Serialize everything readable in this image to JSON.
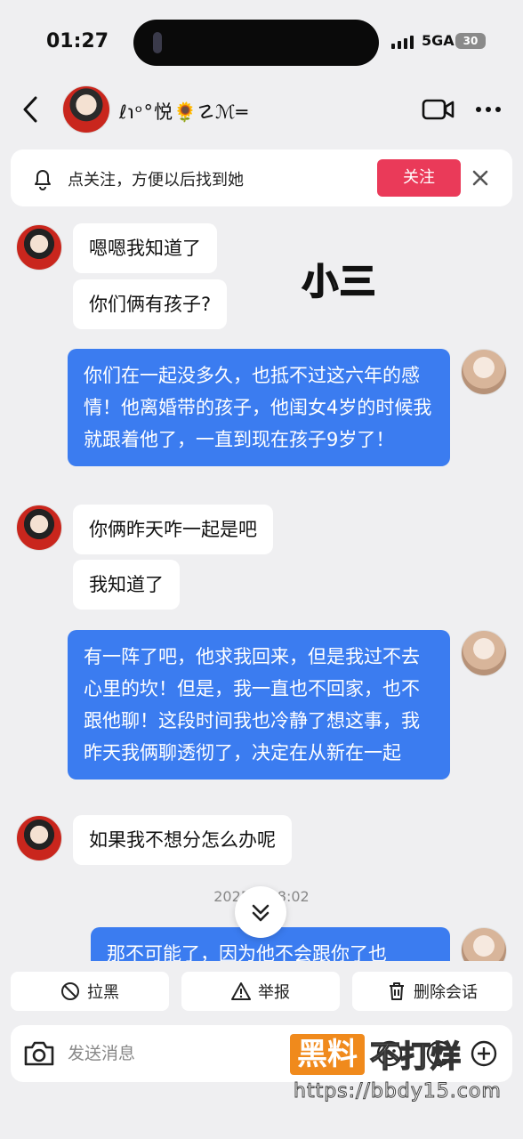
{
  "status_bar": {
    "time": "01:27",
    "network": "5GA",
    "battery": "30"
  },
  "header": {
    "contact_name": "ℓ℩ᵒ°悦🌻☡ℳ═"
  },
  "follow_banner": {
    "text": "点关注，方便以后找到她",
    "button": "关注"
  },
  "overlay_note": "小三",
  "messages": [
    {
      "side": "left",
      "text": "嗯嗯我知道了"
    },
    {
      "side": "left",
      "text": "你们俩有孩子?"
    },
    {
      "side": "right",
      "text": "你们在一起没多久，也抵不过这六年的感情！他离婚带的孩子，他闺女4岁的时候我就跟着他了，一直到现在孩子9岁了！"
    },
    {
      "side": "left",
      "text": "你俩昨天咋一起是吧"
    },
    {
      "side": "left",
      "text": "我知道了"
    },
    {
      "side": "right",
      "text": "有一阵了吧，他求我回来，但是我过不去心里的坎！但是，我一直也不回家，也不跟他聊！这段时间我也冷静了想这事，我昨天我俩聊透彻了，决定在从新在一起"
    },
    {
      "side": "left",
      "text": "如果我不想分怎么办呢"
    },
    {
      "side": "right",
      "text": "那不可能了，因为他不会跟你了也"
    }
  ],
  "timestamp": "2025/1    18:02",
  "actions": {
    "block": "拉黑",
    "report": "举报",
    "delete": "删除会话"
  },
  "input": {
    "placeholder": "发送消息"
  },
  "watermark": {
    "box": "黑料",
    "text": "不打烊",
    "url": "https://bbdy15.com"
  },
  "colors": {
    "accent_red": "#ea3a59",
    "bubble_blue": "#3b7cf0",
    "background": "#efeff1"
  },
  "icons": [
    "back-arrow-icon",
    "video-call-icon",
    "more-icon",
    "bell-icon",
    "close-icon",
    "chevron-down-icon",
    "block-icon",
    "warning-icon",
    "trash-icon",
    "camera-icon",
    "emoji-icon",
    "plus-icon"
  ]
}
